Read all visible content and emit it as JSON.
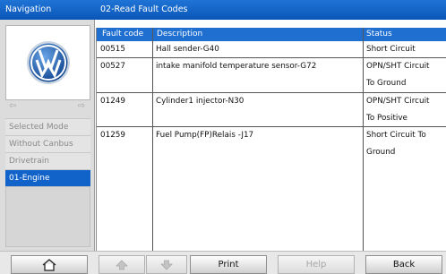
{
  "header": {
    "nav_title": "Navigation",
    "page_title": "02-Read Fault Codes"
  },
  "sidebar": {
    "items": [
      {
        "label": "Selected Mode",
        "active": false
      },
      {
        "label": "Without Canbus",
        "active": false
      },
      {
        "label": "Drivetrain",
        "active": false
      },
      {
        "label": "01-Engine",
        "active": true
      }
    ]
  },
  "table": {
    "columns": [
      "Fault code",
      "Description",
      "Status"
    ],
    "rows": [
      {
        "code": "00515",
        "description": "Hall sender-G40",
        "status": [
          "Short Circuit"
        ]
      },
      {
        "code": "00527",
        "description": "intake manifold temperature sensor-G72",
        "status": [
          "OPN/SHT Circuit",
          "To Ground"
        ]
      },
      {
        "code": "01249",
        "description": "Cylinder1 injector-N30",
        "status": [
          "OPN/SHT Circuit",
          "To Positive"
        ]
      },
      {
        "code": "01259",
        "description": "Fuel Pump(FP)Relais -J17",
        "status": [
          "Short Circuit To",
          "Ground"
        ]
      }
    ]
  },
  "toolbar": {
    "print_label": "Print",
    "help_label": "Help",
    "back_label": "Back"
  },
  "colors": {
    "accent": "#1263c9",
    "header_bg": "#1f6fd1"
  }
}
